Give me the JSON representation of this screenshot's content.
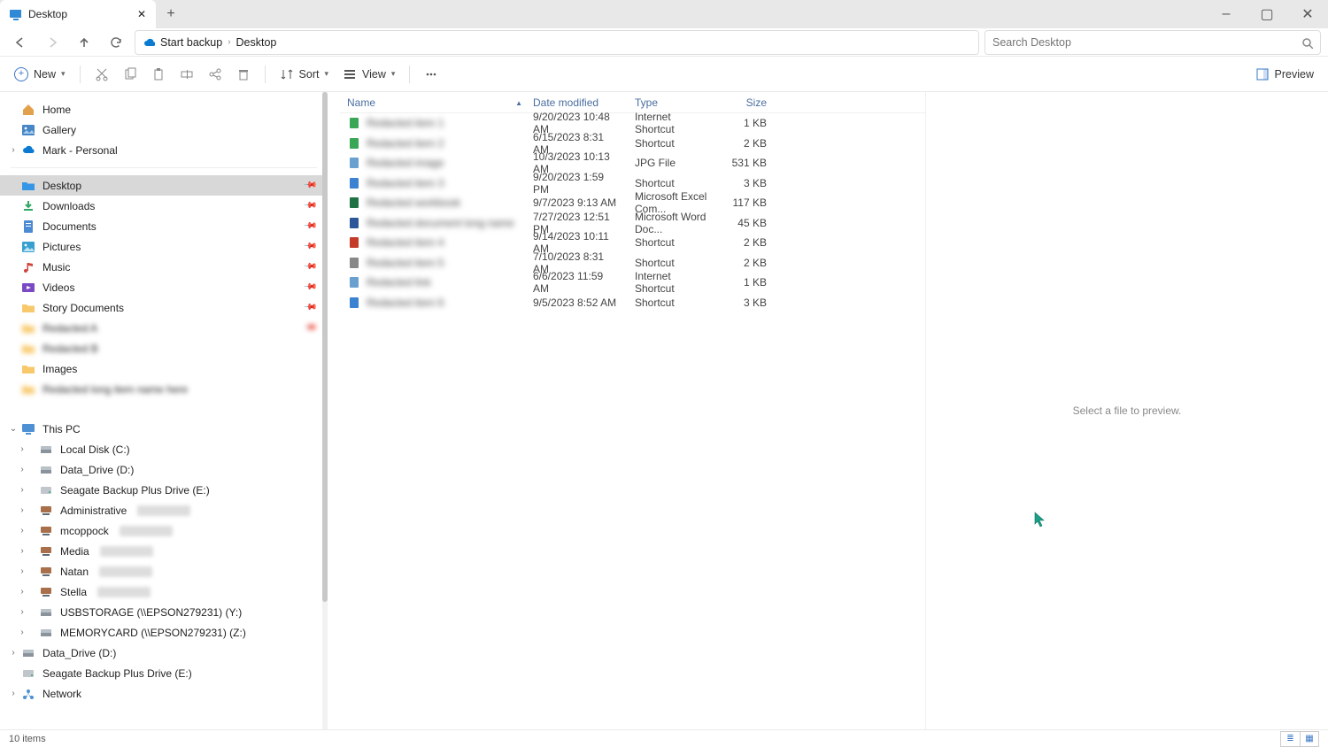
{
  "window": {
    "tab_title": "Desktop",
    "minimize": "–",
    "maximize": "▢",
    "close": "✕",
    "new_tab": "+"
  },
  "nav": {
    "start_backup": "Start backup",
    "crumb_current": "Desktop",
    "search_placeholder": "Search Desktop"
  },
  "toolbar": {
    "new_label": "New",
    "sort_label": "Sort",
    "view_label": "View",
    "preview_label": "Preview"
  },
  "sidebar": {
    "home": "Home",
    "gallery": "Gallery",
    "onedrive": "Mark - Personal",
    "quick": [
      {
        "label": "Desktop",
        "icon": "desktop",
        "selected": true,
        "pinned": true
      },
      {
        "label": "Downloads",
        "icon": "downloads",
        "selected": false,
        "pinned": true
      },
      {
        "label": "Documents",
        "icon": "documents",
        "selected": false,
        "pinned": true
      },
      {
        "label": "Pictures",
        "icon": "pictures",
        "selected": false,
        "pinned": true
      },
      {
        "label": "Music",
        "icon": "music",
        "selected": false,
        "pinned": true
      },
      {
        "label": "Videos",
        "icon": "videos",
        "selected": false,
        "pinned": true
      },
      {
        "label": "Story Documents",
        "icon": "folder",
        "selected": false,
        "pinned": true
      }
    ],
    "quick_blur": [
      {
        "label": "Redacted A"
      },
      {
        "label": "Redacted B"
      }
    ],
    "images_label": "Images",
    "this_pc": "This PC",
    "drives": [
      {
        "label": "Local Disk (C:)",
        "icon": "disk"
      },
      {
        "label": "Data_Drive (D:)",
        "icon": "drive"
      },
      {
        "label": "Seagate Backup Plus Drive (E:)",
        "icon": "ext"
      },
      {
        "label": "Administrative",
        "icon": "net",
        "blurred_suffix": true
      },
      {
        "label": "mcoppock",
        "icon": "net",
        "blurred_suffix": true
      },
      {
        "label": "Media",
        "icon": "net",
        "blurred_suffix": true
      },
      {
        "label": "Natan",
        "icon": "net",
        "blurred_suffix": true
      },
      {
        "label": "Stella",
        "icon": "net",
        "blurred_suffix": true
      },
      {
        "label": "USBSTORAGE (\\\\EPSON279231) (Y:)",
        "icon": "drive"
      },
      {
        "label": "MEMORYCARD (\\\\EPSON279231) (Z:)",
        "icon": "drive"
      }
    ],
    "data_drive_root": "Data_Drive (D:)",
    "seagate_root": "Seagate Backup Plus Drive (E:)",
    "network": "Network"
  },
  "columns": {
    "name": "Name",
    "date": "Date modified",
    "type": "Type",
    "size": "Size"
  },
  "files": [
    {
      "icon": "grn",
      "name": "Redacted item 1",
      "date": "9/20/2023 10:48 AM",
      "type": "Internet Shortcut",
      "size": "1 KB"
    },
    {
      "icon": "grn",
      "name": "Redacted item 2",
      "date": "6/15/2023 8:31 AM",
      "type": "Shortcut",
      "size": "2 KB"
    },
    {
      "icon": "img",
      "name": "Redacted image",
      "date": "10/3/2023 10:13 AM",
      "type": "JPG File",
      "size": "531 KB"
    },
    {
      "icon": "blu",
      "name": "Redacted item 3",
      "date": "9/20/2023 1:59 PM",
      "type": "Shortcut",
      "size": "3 KB"
    },
    {
      "icon": "xls",
      "name": "Redacted workbook",
      "date": "9/7/2023 9:13 AM",
      "type": "Microsoft Excel Com...",
      "size": "117 KB"
    },
    {
      "icon": "doc",
      "name": "Redacted document long name",
      "date": "7/27/2023 12:51 PM",
      "type": "Microsoft Word Doc...",
      "size": "45 KB"
    },
    {
      "icon": "red",
      "name": "Redacted item 4",
      "date": "9/14/2023 10:11 AM",
      "type": "Shortcut",
      "size": "2 KB"
    },
    {
      "icon": "gry",
      "name": "Redacted item 5",
      "date": "7/10/2023 8:31 AM",
      "type": "Shortcut",
      "size": "2 KB"
    },
    {
      "icon": "img",
      "name": "Redacted link",
      "date": "6/6/2023 11:59 AM",
      "type": "Internet Shortcut",
      "size": "1 KB"
    },
    {
      "icon": "blu",
      "name": "Redacted item 6",
      "date": "9/5/2023 8:52 AM",
      "type": "Shortcut",
      "size": "3 KB"
    }
  ],
  "preview_placeholder": "Select a file to preview.",
  "status": {
    "items": "10 items"
  }
}
